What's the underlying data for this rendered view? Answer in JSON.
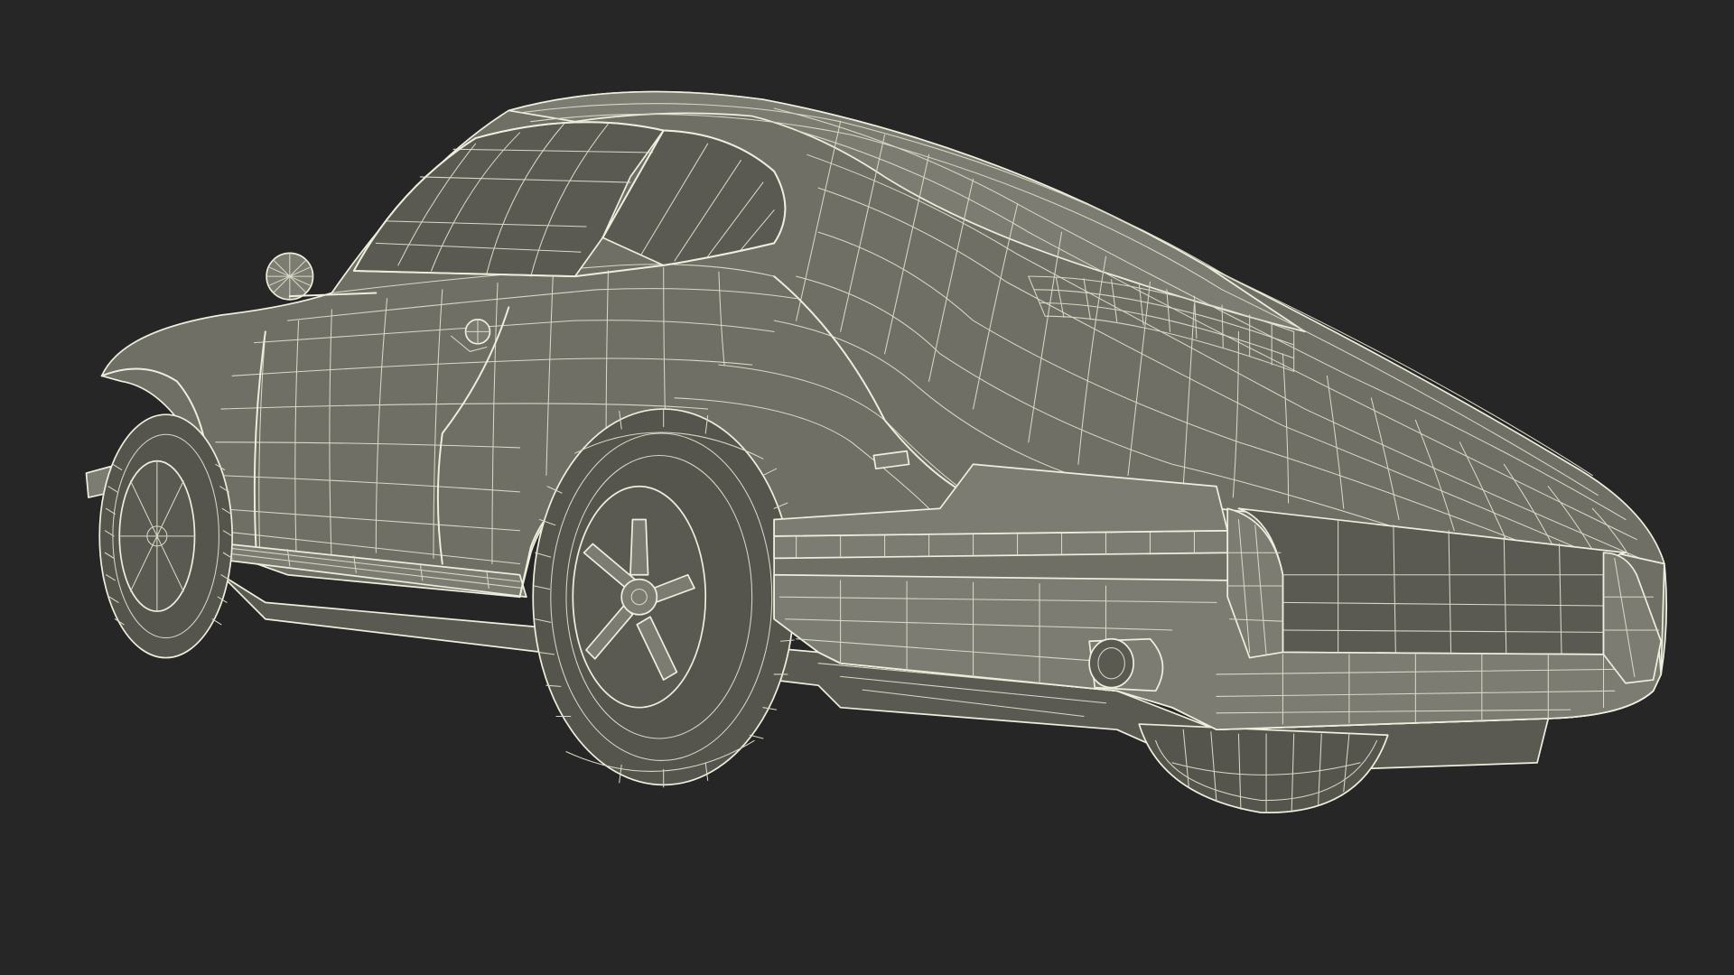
{
  "scene": {
    "subject_icon": "sports-car-wireframe",
    "colors": {
      "background": "#262626",
      "surface": "#6f6f66",
      "surface_light": "#7c7c72",
      "surface_dark": "#5a5a52",
      "tire": "#55554e",
      "wire": "#eeeedd",
      "wire_dim": "#d8d8c4"
    }
  }
}
